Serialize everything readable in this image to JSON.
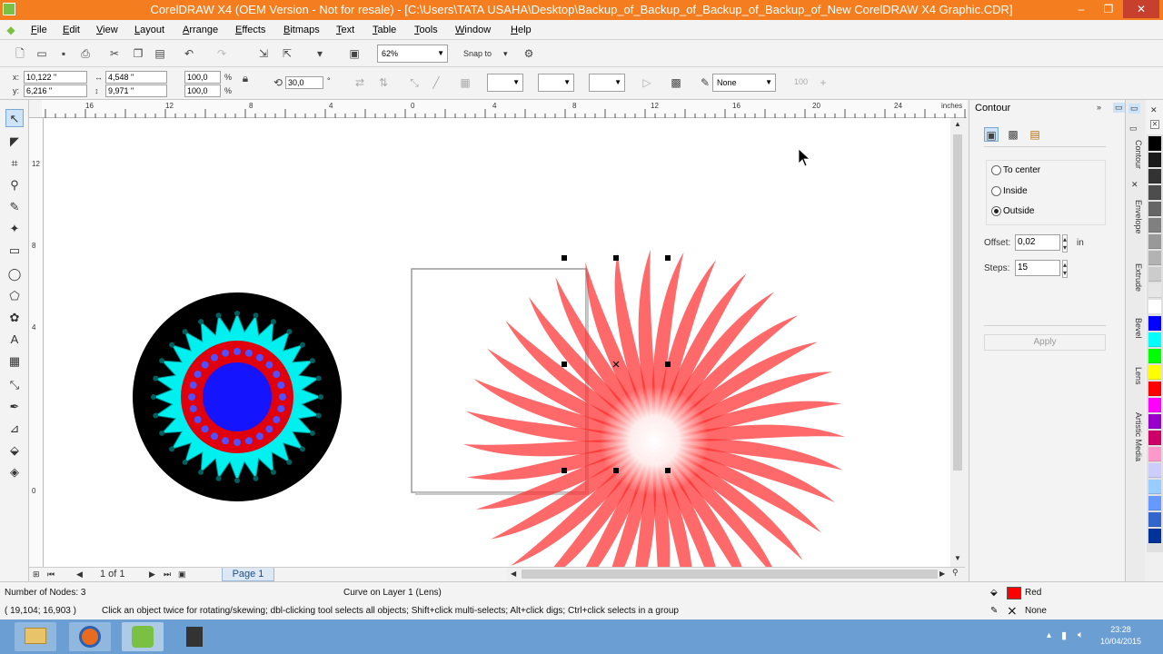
{
  "window": {
    "title": "CorelDRAW X4 (OEM Version - Not for resale) - [C:\\Users\\TATA USAHA\\Desktop\\Backup_of_Backup_of_Backup_of_Backup_of_New CorelDRAW X4 Graphic.CDR]",
    "controls": [
      "–",
      "❐",
      "✕"
    ]
  },
  "menu": [
    "File",
    "Edit",
    "View",
    "Layout",
    "Arrange",
    "Effects",
    "Bitmaps",
    "Text",
    "Table",
    "Tools",
    "Window",
    "Help"
  ],
  "toolbar": {
    "zoom": "62%",
    "snap_to": "Snap to"
  },
  "propbar": {
    "x_label": "x:",
    "x_value": "10,122 \"",
    "y_label": "y:",
    "y_value": "6,216 \"",
    "w_value": "4,548 \"",
    "h_value": "9,971 \"",
    "scale_x": "100,0",
    "scale_y": "100,0",
    "pct": "%",
    "rotation": "30,0",
    "degree": "°",
    "outline": "None",
    "transparency": "100"
  },
  "ruler": {
    "units": "inches",
    "h_ticks": [
      "16",
      "12",
      "8",
      "4",
      "0",
      "4",
      "8",
      "12",
      "16",
      "20",
      "24"
    ],
    "v_ticks": [
      "12",
      "8",
      "4",
      "0"
    ]
  },
  "page_nav": {
    "counter": "1 of 1",
    "page_tab": "Page 1"
  },
  "docker": {
    "title": "Contour",
    "options": [
      {
        "label": "To center",
        "selected": false
      },
      {
        "label": "Inside",
        "selected": false
      },
      {
        "label": "Outside",
        "selected": true
      }
    ],
    "offset_label": "Offset:",
    "offset_value": "0,02",
    "offset_unit": "in",
    "steps_label": "Steps:",
    "steps_value": "15",
    "apply_label": "Apply",
    "tabs": [
      "Contour",
      "Envelope",
      "Extrude",
      "Bevel",
      "Lens",
      "Artistic Media"
    ]
  },
  "palette_colors": [
    "#000000",
    "#1a1a1a",
    "#333333",
    "#4d4d4d",
    "#666666",
    "#808080",
    "#999999",
    "#b3b3b3",
    "#cccccc",
    "#e6e6e6",
    "#ffffff",
    "#0000ff",
    "#00ffff",
    "#00ff00",
    "#ffff00",
    "#ff0000",
    "#ff00ff",
    "#9900cc",
    "#cc0066",
    "#ff99cc",
    "#ccccff",
    "#99ccff",
    "#6699ff",
    "#3366cc",
    "#003399"
  ],
  "status": {
    "nodes": "Number of Nodes: 3",
    "object": "Curve on Layer 1  (Lens)",
    "coords": "( 19,104; 16,903 )",
    "hint": "Click an object twice for rotating/skewing; dbl-clicking tool selects all objects; Shift+click multi-selects; Alt+click digs; Ctrl+click selects in a group",
    "fill_label": "Red",
    "fill_color": "#ff0000",
    "outline_label": "None"
  },
  "taskbar": {
    "time": "23:28",
    "date": "10/04/2015"
  }
}
